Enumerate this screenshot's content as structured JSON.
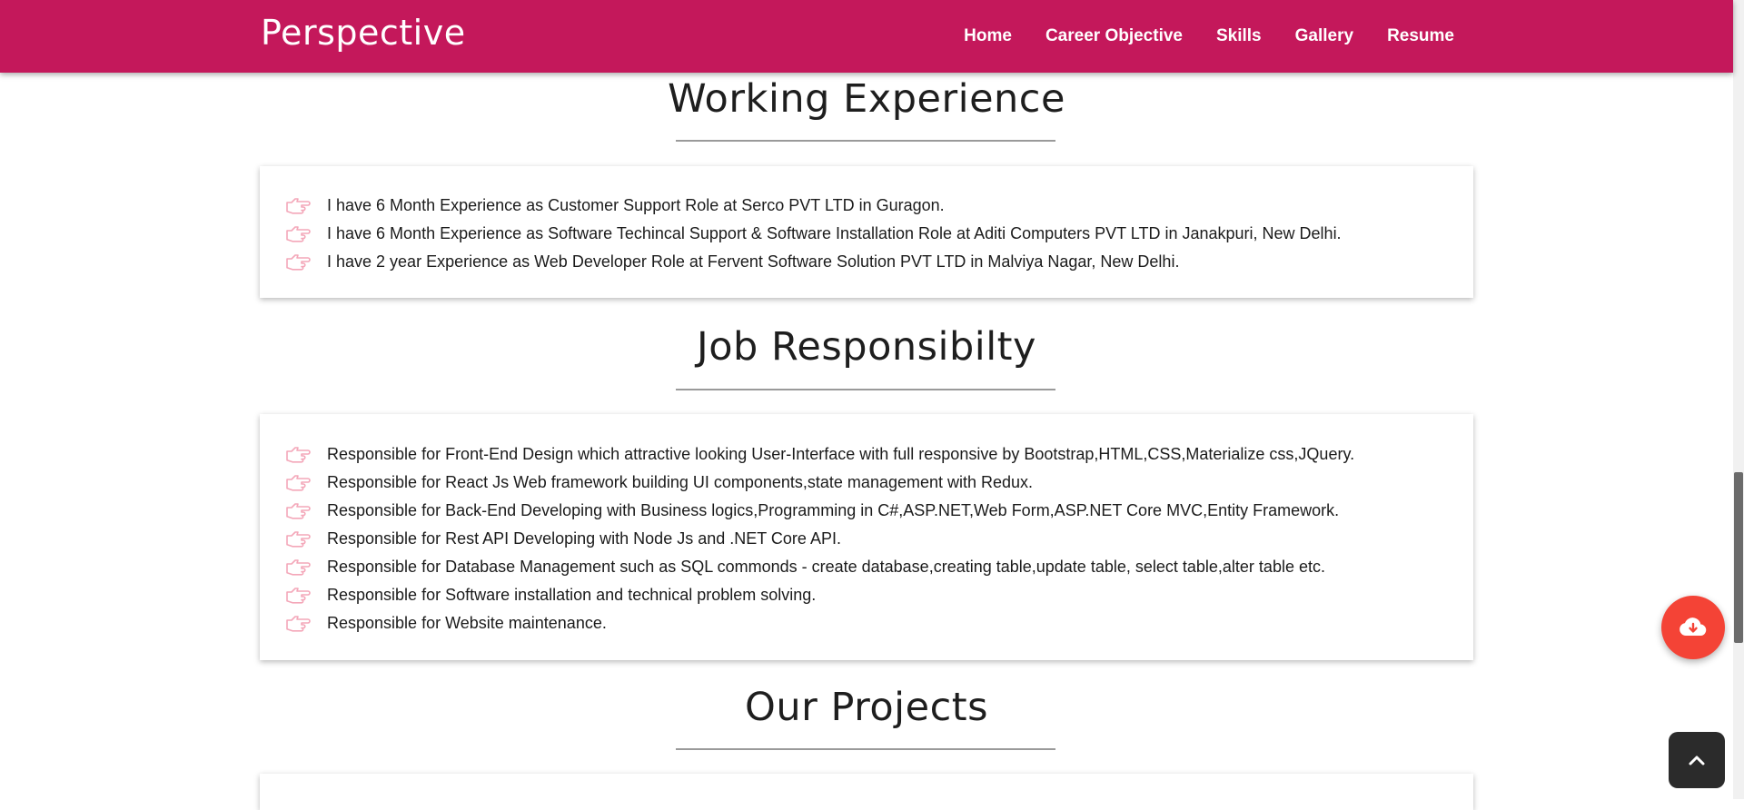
{
  "navbar": {
    "brand": "Perspective",
    "links": [
      "Home",
      "Career Objective",
      "Skills",
      "Gallery",
      "Resume"
    ]
  },
  "working_experience": {
    "title": "Working Experience",
    "items": [
      "I have 6 Month Experience as Customer Support Role at Serco PVT LTD in Guragon.",
      "I have 6 Month Experience as Software Techincal Support & Software Installation Role at Aditi Computers PVT LTD in Janakpuri, New Delhi.",
      "I have 2 year Experience as Web Developer Role at Fervent Software Solution PVT LTD in Malviya Nagar, New Delhi."
    ]
  },
  "job_responsibility": {
    "title": "Job Responsibilty",
    "items": [
      "Responsible for Front-End Design which attractive looking User-Interface with full responsive by Bootstrap,HTML,CSS,Materialize css,JQuery.",
      "Responsible for React Js Web framework building UI components,state management with Redux.",
      "Responsible for Back-End Developing with Business logics,Programming in C#,ASP.NET,Web Form,ASP.NET Core MVC,Entity Framework.",
      "Responsible for Rest API Developing with Node Js and .NET Core API.",
      "Responsible for Database Management such as SQL commonds - create database,creating table,update table, select table,alter table etc.",
      "Responsible for Software installation and technical problem solving.",
      "Responsible for Website maintenance."
    ]
  },
  "projects": {
    "title": "Our Projects"
  },
  "icons": {
    "list_bullet": "hand-point-right-icon",
    "download": "cloud-download-icon",
    "scroll_top": "chevron-up-icon"
  },
  "colors": {
    "navbar": "#c4185b",
    "bullet": "#f4a7b9",
    "download_button": "#f44336",
    "scroll_top_button": "#2b2b2b"
  }
}
